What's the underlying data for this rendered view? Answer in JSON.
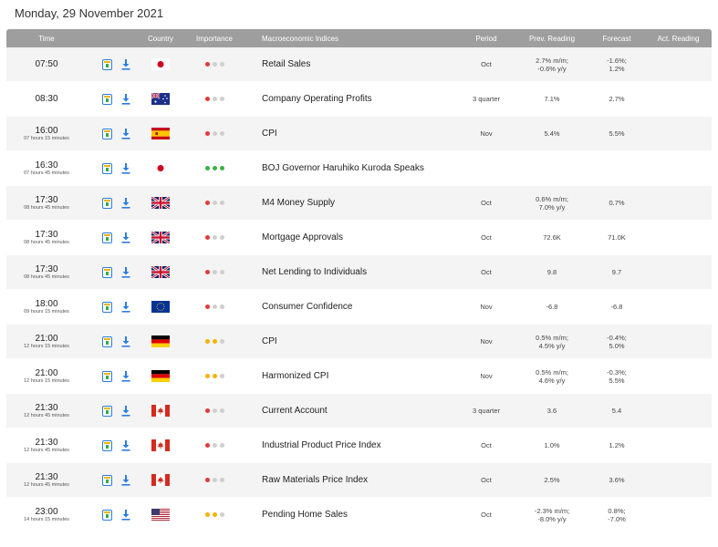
{
  "page": {
    "date_title": "Monday, 29 November 2021"
  },
  "columns": {
    "time": "Time",
    "country": "Country",
    "importance": "Importance",
    "indices": "Macroeconomic Indices",
    "period": "Period",
    "prev": "Prev. Reading",
    "forecast": "Forecast",
    "actual": "Act. Reading"
  },
  "colors": {
    "high": "#e53935",
    "medium": "#f5b300",
    "low_active_green": "#3cb043",
    "inactive": "#cfcfcf",
    "header_bg": "#9e9e9e"
  },
  "icons": {
    "calendar": "calendar-icon",
    "download": "download-icon"
  },
  "events": [
    {
      "time": "07:50",
      "countdown": "",
      "country": "japan",
      "importance": "low-red",
      "name": "Retail Sales",
      "period": "Oct",
      "prev": [
        "2.7% m/m;",
        "-0.6% y/y"
      ],
      "forecast": [
        "-1.6%;",
        "1.2%"
      ],
      "actual": ""
    },
    {
      "time": "08:30",
      "countdown": "",
      "country": "australia",
      "importance": "low-red",
      "name": "Company Operating Profits",
      "period": "3 quarter",
      "prev": [
        "7.1%"
      ],
      "forecast": [
        "2.7%"
      ],
      "actual": ""
    },
    {
      "time": "16:00",
      "countdown": "07 hours 15 minutes",
      "country": "spain",
      "importance": "low-red",
      "name": "CPI",
      "period": "Nov",
      "prev": [
        "5.4%"
      ],
      "forecast": [
        "5.5%"
      ],
      "actual": ""
    },
    {
      "time": "16:30",
      "countdown": "07 hours 45 minutes",
      "country": "japan",
      "importance": "high-green",
      "name": "BOJ Governor Haruhiko Kuroda Speaks",
      "period": "",
      "prev": [],
      "forecast": [],
      "actual": ""
    },
    {
      "time": "17:30",
      "countdown": "08 hours 45 minutes",
      "country": "uk",
      "importance": "low-red",
      "name": "M4 Money Supply",
      "period": "Oct",
      "prev": [
        "0.6% m/m;",
        "7.0% y/y"
      ],
      "forecast": [
        "0.7%"
      ],
      "actual": ""
    },
    {
      "time": "17:30",
      "countdown": "08 hours 45 minutes",
      "country": "uk",
      "importance": "low-red",
      "name": "Mortgage Approvals",
      "period": "Oct",
      "prev": [
        "72.6K"
      ],
      "forecast": [
        "71.0K"
      ],
      "actual": ""
    },
    {
      "time": "17:30",
      "countdown": "08 hours 45 minutes",
      "country": "uk",
      "importance": "low-red",
      "name": "Net Lending to Individuals",
      "period": "Oct",
      "prev": [
        "9.8"
      ],
      "forecast": [
        "9.7"
      ],
      "actual": ""
    },
    {
      "time": "18:00",
      "countdown": "09 hours 15 minutes",
      "country": "eu",
      "importance": "low-red",
      "name": "Consumer Confidence",
      "period": "Nov",
      "prev": [
        "-6.8"
      ],
      "forecast": [
        "-6.8"
      ],
      "actual": ""
    },
    {
      "time": "21:00",
      "countdown": "12 hours 15 minutes",
      "country": "germany",
      "importance": "medium-yellow",
      "name": "CPI",
      "period": "Nov",
      "prev": [
        "0.5% m/m;",
        "4.5% y/y"
      ],
      "forecast": [
        "-0.4%;",
        "5.0%"
      ],
      "actual": ""
    },
    {
      "time": "21:00",
      "countdown": "12 hours 15 minutes",
      "country": "germany",
      "importance": "medium-yellow",
      "name": "Harmonized CPI",
      "period": "Nov",
      "prev": [
        "0.5% m/m;",
        "4.6% y/y"
      ],
      "forecast": [
        "-0.3%;",
        "5.5%"
      ],
      "actual": ""
    },
    {
      "time": "21:30",
      "countdown": "12 hours 45 minutes",
      "country": "canada",
      "importance": "low-red",
      "name": "Current Account",
      "period": "3 quarter",
      "prev": [
        "3.6"
      ],
      "forecast": [
        "5.4"
      ],
      "actual": ""
    },
    {
      "time": "21:30",
      "countdown": "12 hours 45 minutes",
      "country": "canada",
      "importance": "low-red",
      "name": "Industrial Product Price Index",
      "period": "Oct",
      "prev": [
        "1.0%"
      ],
      "forecast": [
        "1.2%"
      ],
      "actual": ""
    },
    {
      "time": "21:30",
      "countdown": "12 hours 45 minutes",
      "country": "canada",
      "importance": "low-red",
      "name": "Raw Materials Price Index",
      "period": "Oct",
      "prev": [
        "2.5%"
      ],
      "forecast": [
        "3.6%"
      ],
      "actual": ""
    },
    {
      "time": "23:00",
      "countdown": "14 hours 15 minutes",
      "country": "usa",
      "importance": "medium-yellow",
      "name": "Pending Home Sales",
      "period": "Oct",
      "prev": [
        "-2.3% m/m;",
        "-8.0% y/y"
      ],
      "forecast": [
        "0.8%;",
        "-7.0%"
      ],
      "actual": ""
    }
  ]
}
